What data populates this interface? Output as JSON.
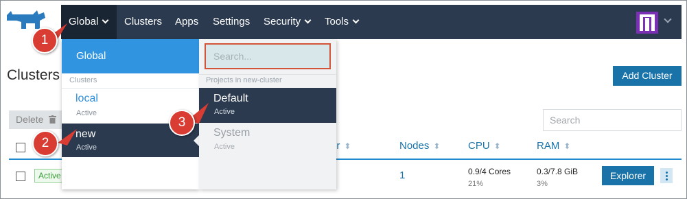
{
  "colors": {
    "navbar": "#2b3a4f",
    "nav_active": "#1a2534",
    "accent_blue": "#1973a9",
    "dropdown_highlight": "#3094e0",
    "callout_red": "#d83c33",
    "active_green": "#3a9a3a"
  },
  "icons": {
    "logo": "rancher-cow-logo",
    "user": "user-avatar-icon",
    "delete": "trash-icon",
    "sort": "sort-arrows-icon",
    "more": "kebab-menu-icon"
  },
  "nav": {
    "global": "Global",
    "clusters": "Clusters",
    "apps": "Apps",
    "settings": "Settings",
    "security": "Security",
    "tools": "Tools"
  },
  "page": {
    "title": "Clusters",
    "add_cluster": "Add Cluster",
    "delete": "Delete",
    "search_placeholder": "Search"
  },
  "table": {
    "headers": {
      "provider_fragment": "er",
      "nodes": "Nodes",
      "cpu": "CPU",
      "ram": "RAM"
    },
    "rows": [
      {
        "state": "Active",
        "nodes": "1",
        "cpu": "0.9/4 Cores",
        "cpu_pct": "21%",
        "ram": "0.3/7.8 GiB",
        "ram_pct": "3%",
        "action": "Explorer"
      }
    ]
  },
  "dropdown": {
    "global_item": "Global",
    "clusters_label": "Clusters",
    "clusters": [
      {
        "name": "local",
        "status": "Active"
      },
      {
        "name": "new",
        "status": "Active"
      }
    ],
    "search_placeholder": "Search...",
    "projects_label": "Projects in new-cluster",
    "projects": [
      {
        "name": "Default",
        "status": "Active"
      },
      {
        "name": "System",
        "status": "Active"
      }
    ]
  },
  "callouts": [
    "1",
    "2",
    "3"
  ]
}
